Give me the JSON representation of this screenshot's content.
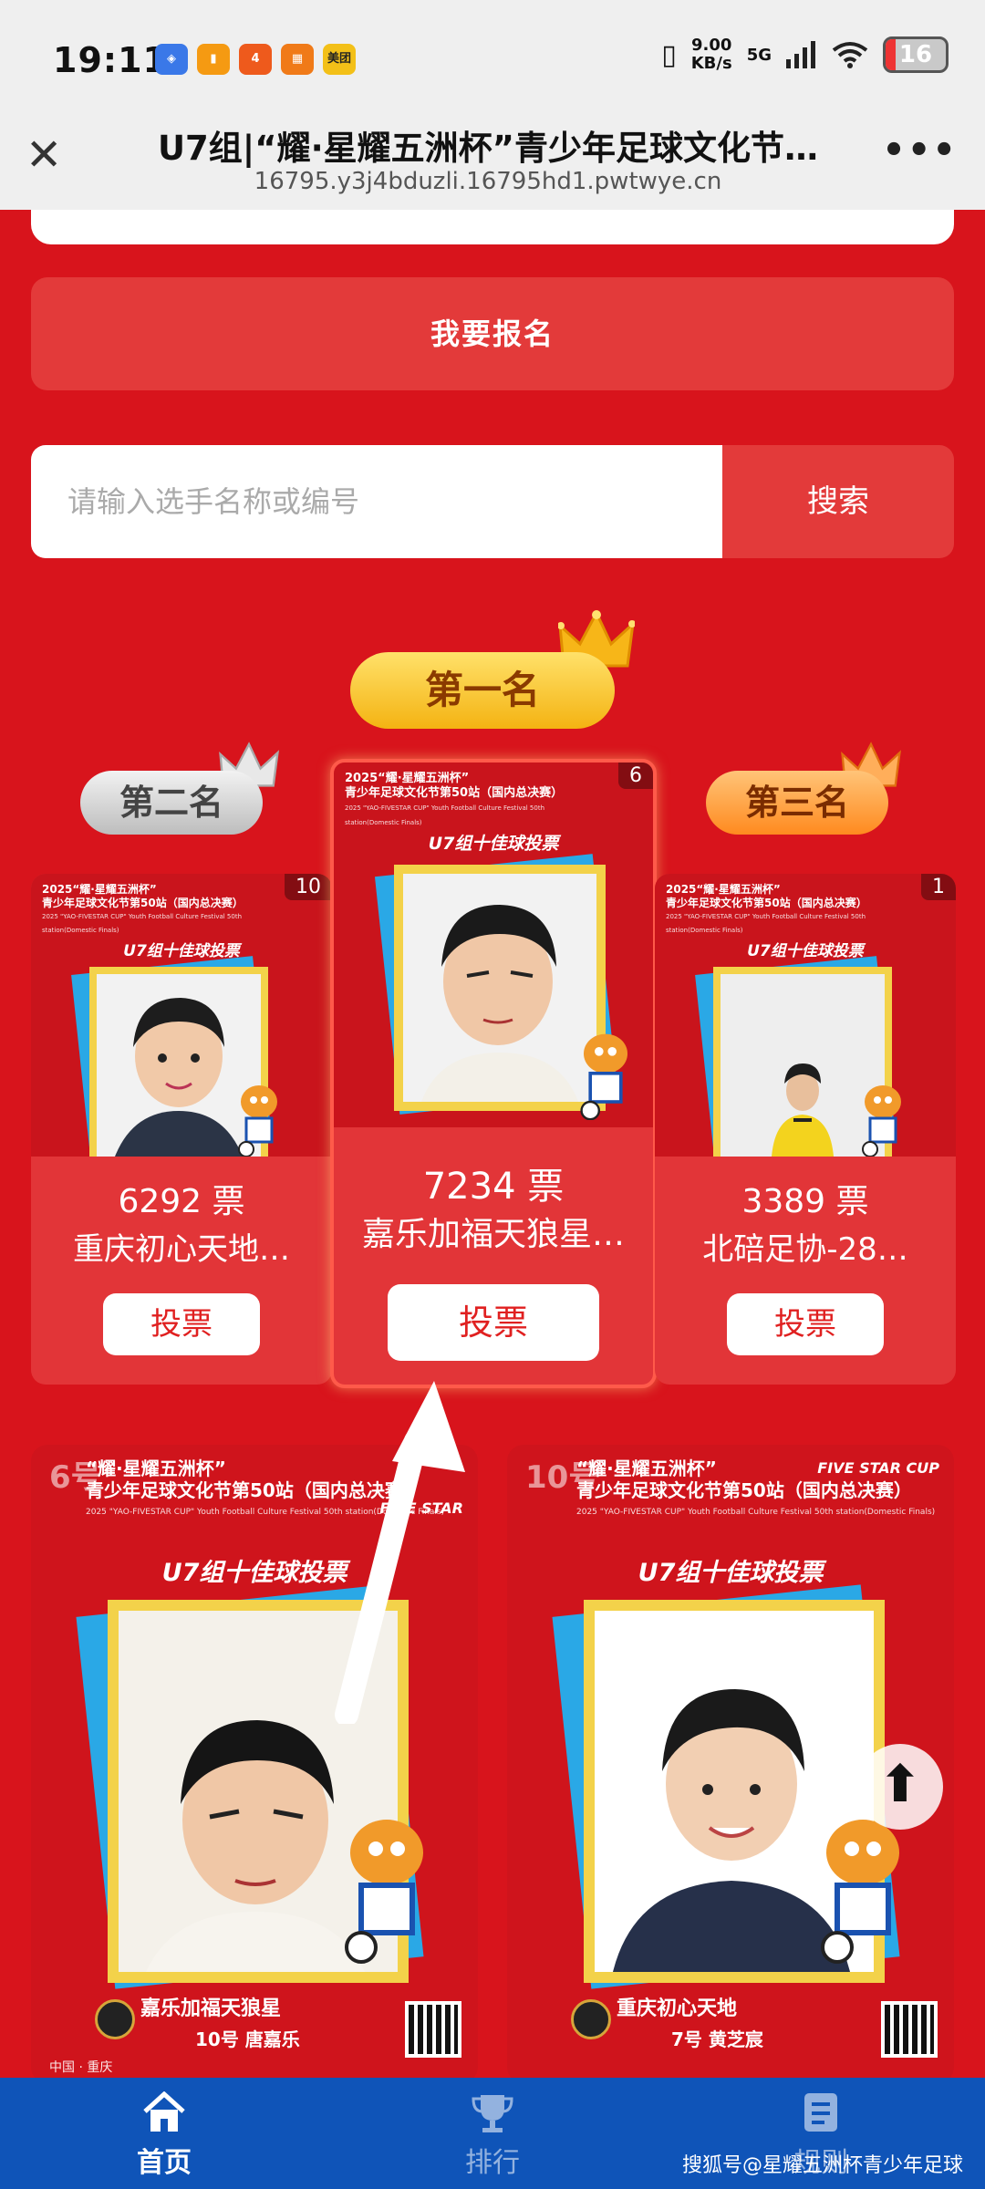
{
  "status_bar": {
    "time": "19:11",
    "network_speed_value": "9.00",
    "network_speed_unit": "KB/s",
    "signal": "5G",
    "battery": "16",
    "apps": [
      {
        "icon": "app-icon-blue",
        "color": "#3a78e8"
      },
      {
        "icon": "app-icon-orange",
        "color": "#f59a12"
      },
      {
        "icon": "app-icon-red",
        "color": "#ee5a1c"
      },
      {
        "icon": "app-icon-orange2",
        "color": "#f07a18"
      },
      {
        "icon": "meituan-icon",
        "color": "#f3c018",
        "label": "美团"
      }
    ]
  },
  "browser": {
    "title": "U7组|“耀·星耀五洲杯”青少年足球文化节…",
    "url": "16795.y3j4bduzli.16795hd1.pwtwye.cn"
  },
  "actions": {
    "signup_label": "我要报名",
    "search_placeholder": "请输入选手名称或编号",
    "search_button": "搜索"
  },
  "ranking": {
    "first_label": "第一名",
    "second_label": "第二名",
    "third_label": "第三名",
    "poster_title": "2025“耀·星耀五洲杯”",
    "poster_subtitle": "青少年足球文化节第50站（国内总决赛）",
    "poster_en": "2025 \"YAO-FIVESTAR CUP\" Youth Football Culture Festival 50th station(Domestic Finals)",
    "poster_caption": "U7组十佳球投票",
    "entries": [
      {
        "rank": "2",
        "badge": "10",
        "votes": "6292 票",
        "team": "重庆初心天地…",
        "vote_label": "投票"
      },
      {
        "rank": "1",
        "badge": "6",
        "votes": "7234 票",
        "team": "嘉乐加福天狼星…",
        "vote_label": "投票"
      },
      {
        "rank": "3",
        "badge": "1",
        "votes": "3389 票",
        "team": "北碚足协-28…",
        "vote_label": "投票"
      }
    ]
  },
  "list_cards": [
    {
      "num": "6号",
      "title": "“耀·星耀五洲杯”",
      "subtitle": "青少年足球文化节第50站（国内总决赛）",
      "en": "2025 \"YAO-FIVESTAR CUP\" Youth Football Culture Festival 50th station(Domestic Finals)",
      "caption": "U7组十佳球投票",
      "logo": "FIVE STAR",
      "team": "嘉乐加福天狼星",
      "player": "10号  唐嘉乐",
      "location": "中国 · 重庆"
    },
    {
      "num": "10号",
      "title": "“耀·星耀五洲杯”",
      "subtitle": "青少年足球文化节第50站（国内总决赛）",
      "en": "2025 \"YAO-FIVESTAR CUP\" Youth Football Culture Festival 50th station(Domestic Finals)",
      "caption": "U7组十佳球投票",
      "logo": "FIVE STAR CUP",
      "team": "重庆初心天地",
      "player": "7号  黄芝宸",
      "location": ""
    }
  ],
  "bottom_nav": [
    {
      "label": "首页",
      "icon": "home-icon",
      "active": true
    },
    {
      "label": "排行",
      "icon": "trophy-icon",
      "active": false
    },
    {
      "label": "规则",
      "icon": "rules-icon",
      "active": false
    }
  ],
  "watermark": "搜狐号@星耀五洲杯青少年足球",
  "colors": {
    "page_bg": "#d8141c",
    "button_red": "#e33a3a",
    "gold": "#f4b312",
    "nav_blue": "#0f54b8"
  }
}
